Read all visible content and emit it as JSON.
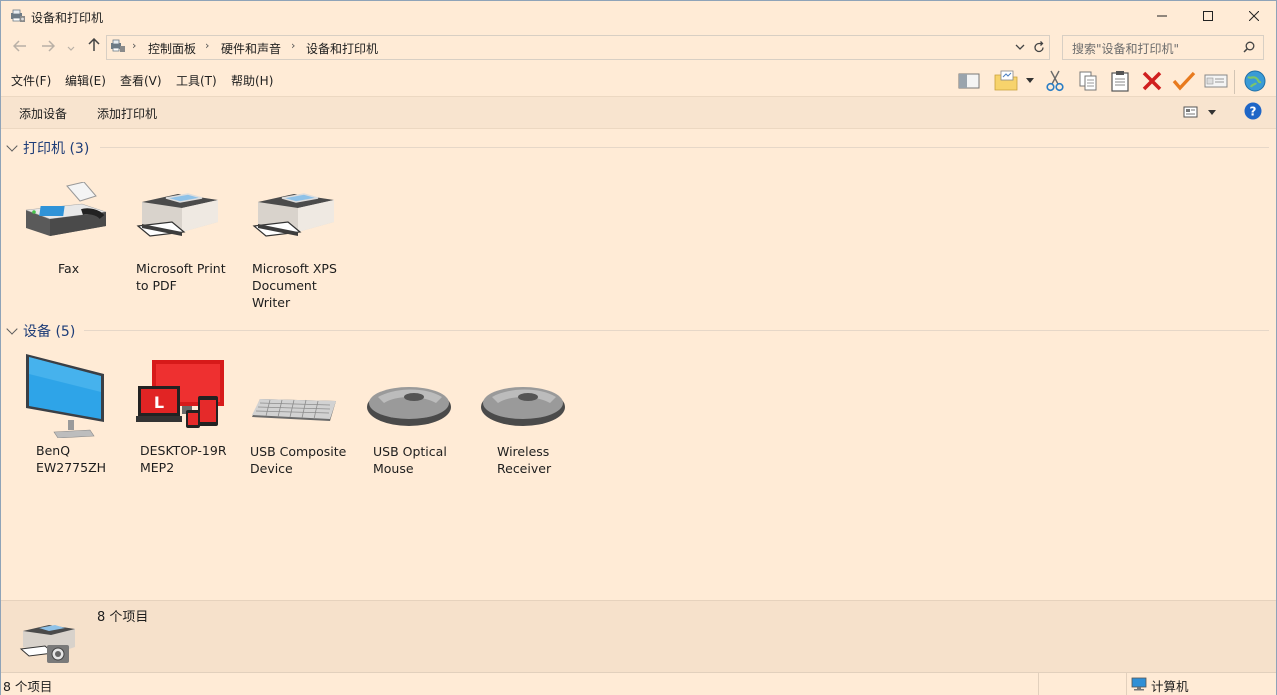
{
  "window": {
    "title": "设备和打印机"
  },
  "nav": {
    "breadcrumbs": [
      "控制面板",
      "硬件和声音",
      "设备和打印机"
    ],
    "search_placeholder": "搜索\"设备和打印机\""
  },
  "menu": [
    "文件(F)",
    "编辑(E)",
    "查看(V)",
    "工具(T)",
    "帮助(H)"
  ],
  "commands": {
    "add_device": "添加设备",
    "add_printer": "添加打印机"
  },
  "groups": {
    "printers": {
      "header": "打印机 (3)",
      "items": [
        {
          "label_lines": [
            "Fax"
          ],
          "icon": "fax-icon"
        },
        {
          "label_lines": [
            "Microsoft Print",
            "to PDF"
          ],
          "icon": "printer-icon"
        },
        {
          "label_lines": [
            "Microsoft XPS",
            "Document",
            "Writer"
          ],
          "icon": "printer-icon"
        }
      ]
    },
    "devices": {
      "header": "设备 (5)",
      "items": [
        {
          "label_lines": [
            "BenQ",
            "EW2775ZH"
          ],
          "icon": "monitor-icon"
        },
        {
          "label_lines": [
            "DESKTOP-19R",
            "MEP2"
          ],
          "icon": "computer-icon"
        },
        {
          "label_lines": [
            "USB Composite",
            "Device"
          ],
          "icon": "keyboard-icon"
        },
        {
          "label_lines": [
            "USB Optical",
            "Mouse"
          ],
          "icon": "mouse-icon"
        },
        {
          "label_lines": [
            "Wireless",
            "Receiver"
          ],
          "icon": "mouse-icon"
        }
      ]
    }
  },
  "details": {
    "summary": "8 个项目"
  },
  "status": {
    "count": "8 个项目",
    "location": "计算机"
  },
  "colors": {
    "background": "#ffebd6",
    "group_header": "#1e3d78",
    "delete_red": "#d01f1f",
    "check_orange": "#e87a1e"
  }
}
